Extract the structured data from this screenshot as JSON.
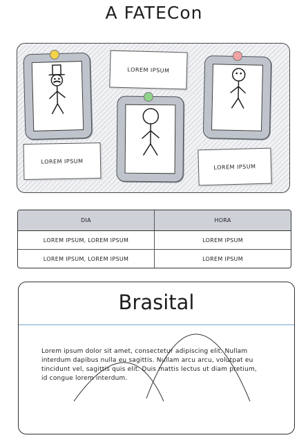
{
  "page": {
    "title": "A FATECon"
  },
  "board": {
    "notes": [
      "LOREM IPSUM",
      "LOREM IPSUM",
      "LOREM IPSUM"
    ],
    "pin_colors": [
      "#f2d14b",
      "#8fd48a",
      "#f2a3a3"
    ]
  },
  "schedule": {
    "headers": [
      "DIA",
      "HORA"
    ],
    "rows": [
      [
        "LOREM IPSUM, LOREM IPSUM",
        "LOREM IPSUM"
      ],
      [
        "LOREM IPSUM, LOREM IPSUM",
        "LOREM IPSUM"
      ]
    ]
  },
  "card": {
    "title": "Brasital",
    "text": "Lorem ipsum dolor sit amet, consectetur adipiscing elit. Nullam interdum dapibus nulla eu sagittis. Nullam arcu arcu, volutpat eu tincidunt vel, sagittis quis elit. Duis mattis lectus ut diam pretium, id congue lorem interdum."
  }
}
